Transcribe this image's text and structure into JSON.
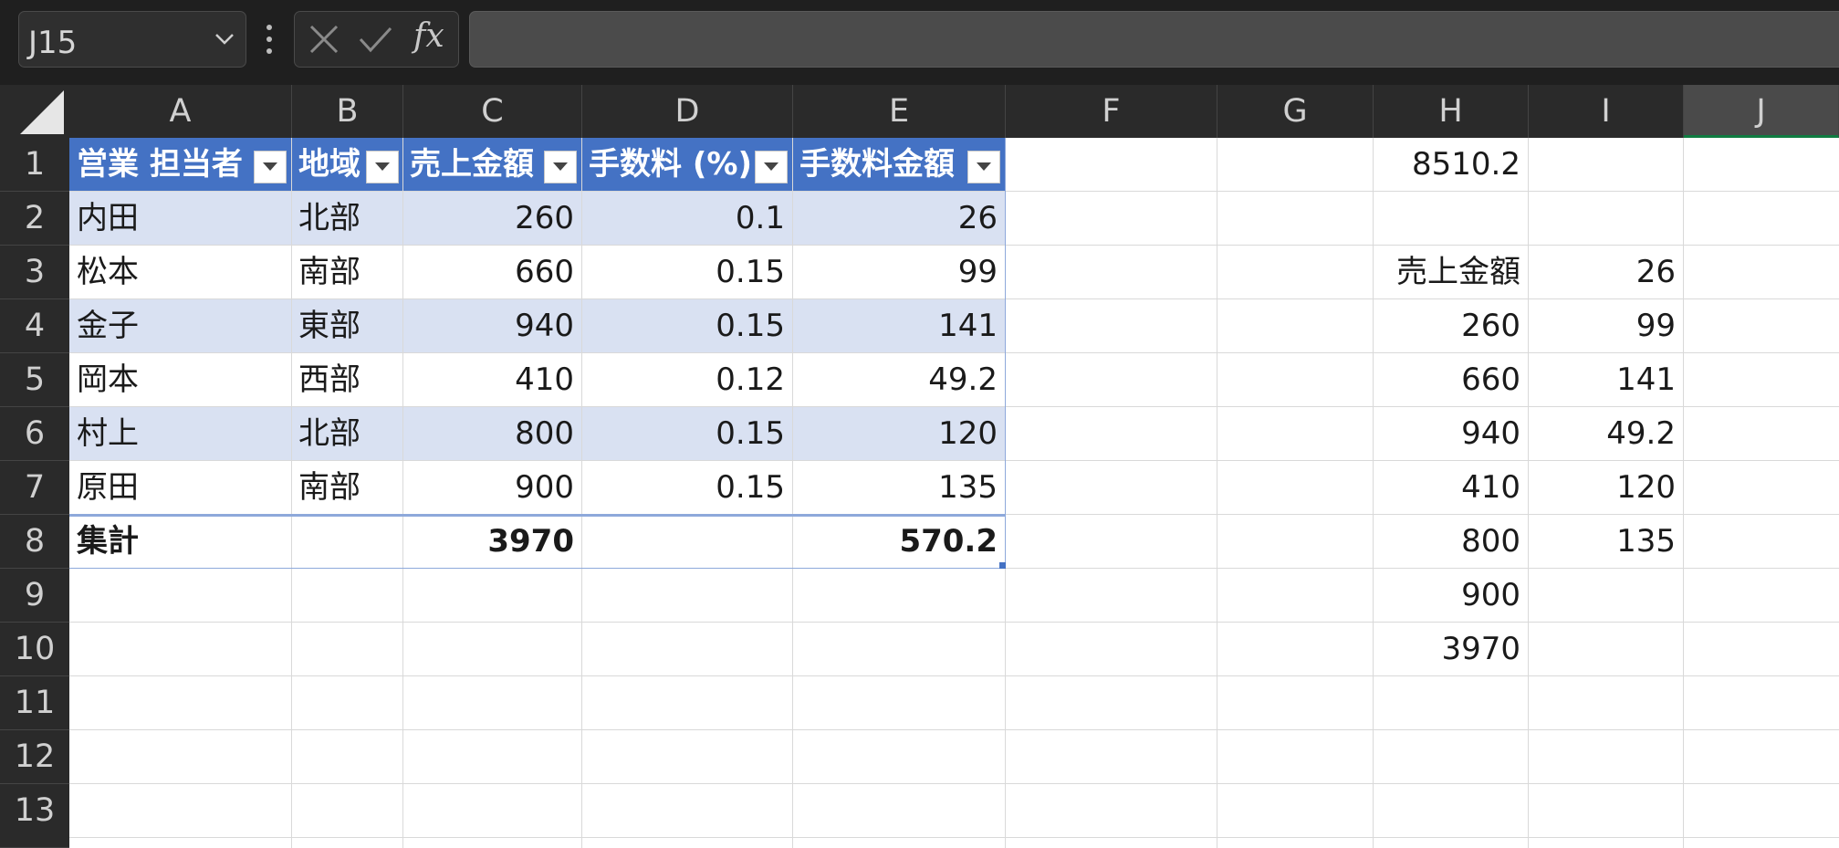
{
  "formula_bar": {
    "name_box": "J15",
    "fx_label": "fx",
    "formula": ""
  },
  "columns": [
    "A",
    "B",
    "C",
    "D",
    "E",
    "F",
    "G",
    "H",
    "I",
    "J"
  ],
  "selected_column": "J",
  "rows": [
    "1",
    "2",
    "3",
    "4",
    "5",
    "6",
    "7",
    "8",
    "9",
    "10",
    "11",
    "12",
    "13"
  ],
  "table": {
    "headers": [
      "営業 担当者",
      "地域",
      "売上金額",
      "手数料 (%)",
      "手数料金額"
    ],
    "rows": [
      [
        "内田",
        "北部",
        "260",
        "0.1",
        "26"
      ],
      [
        "松本",
        "南部",
        "660",
        "0.15",
        "99"
      ],
      [
        "金子",
        "東部",
        "940",
        "0.15",
        "141"
      ],
      [
        "岡本",
        "西部",
        "410",
        "0.12",
        "49.2"
      ],
      [
        "村上",
        "北部",
        "800",
        "0.15",
        "120"
      ],
      [
        "原田",
        "南部",
        "900",
        "0.15",
        "135"
      ]
    ],
    "total_label": "集計",
    "total_sales": "3970",
    "total_commission": "570.2"
  },
  "side": {
    "h1": "8510.2",
    "h3": "売上金額",
    "h_values": [
      "260",
      "660",
      "940",
      "410",
      "800",
      "900",
      "3970"
    ],
    "i_values": [
      "26",
      "99",
      "141",
      "49.2",
      "120",
      "135"
    ]
  },
  "colors": {
    "table_header": "#4472c4",
    "band": "#d9e1f2",
    "selection_accent": "#107c41"
  }
}
